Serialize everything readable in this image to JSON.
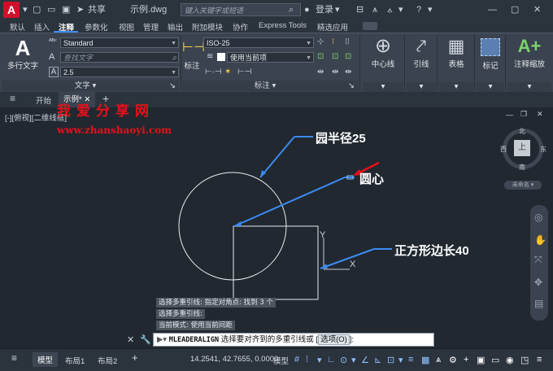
{
  "title_bar": {
    "share_label": "共享",
    "file_name": "示例.dwg",
    "search_placeholder": "键入关键字或短语",
    "login_label": "登录"
  },
  "menu_tabs": [
    "默认",
    "插入",
    "注释",
    "参数化",
    "视图",
    "管理",
    "输出",
    "附加模块",
    "协作",
    "Express Tools",
    "精选应用"
  ],
  "active_menu_tab": "注释",
  "ribbon": {
    "text_panel": {
      "big_button": "多行文字",
      "style_value": "Standard",
      "find_placeholder": "查找文字",
      "height_value": "2.5",
      "label": "文字"
    },
    "dim_panel": {
      "big_button": "标注",
      "dimstyle_value": "ISO-25",
      "layer_value": "使用当前项",
      "label": "标注"
    },
    "buttons": [
      "中心线",
      "引线",
      "表格",
      "标记",
      "注释缩放"
    ]
  },
  "doc_tabs": [
    "开始",
    "示例*"
  ],
  "watermark": {
    "chars": [
      "我",
      "爱",
      "分",
      "享",
      "网"
    ],
    "url": "www.zhanshaoyi.com"
  },
  "viewport_label": "[-][俯视][二维线框]",
  "annotations": {
    "radius": "园半径25",
    "center": "圆心",
    "square": "正方形边长40"
  },
  "axis": {
    "x": "X",
    "y": "Y"
  },
  "viewcube": {
    "north": "北",
    "south": "南",
    "east": "东",
    "west": "西",
    "top": "上",
    "wcs": "未命名"
  },
  "command_history": [
    "选择多重引线: 指定对角点: 找到 3 个",
    "选择多重引线:",
    "当前模式: 使用当前间距"
  ],
  "command_line": {
    "command": "MLEADERALIGN",
    "prompt": "选择要对齐到的多重引线或 [",
    "option": "选项(O)",
    "suffix": "]:"
  },
  "layout_tabs": [
    "模型",
    "布局1",
    "布局2"
  ],
  "status": {
    "coords": "14.2541, 42.7655, 0.0000",
    "space": "模型"
  }
}
